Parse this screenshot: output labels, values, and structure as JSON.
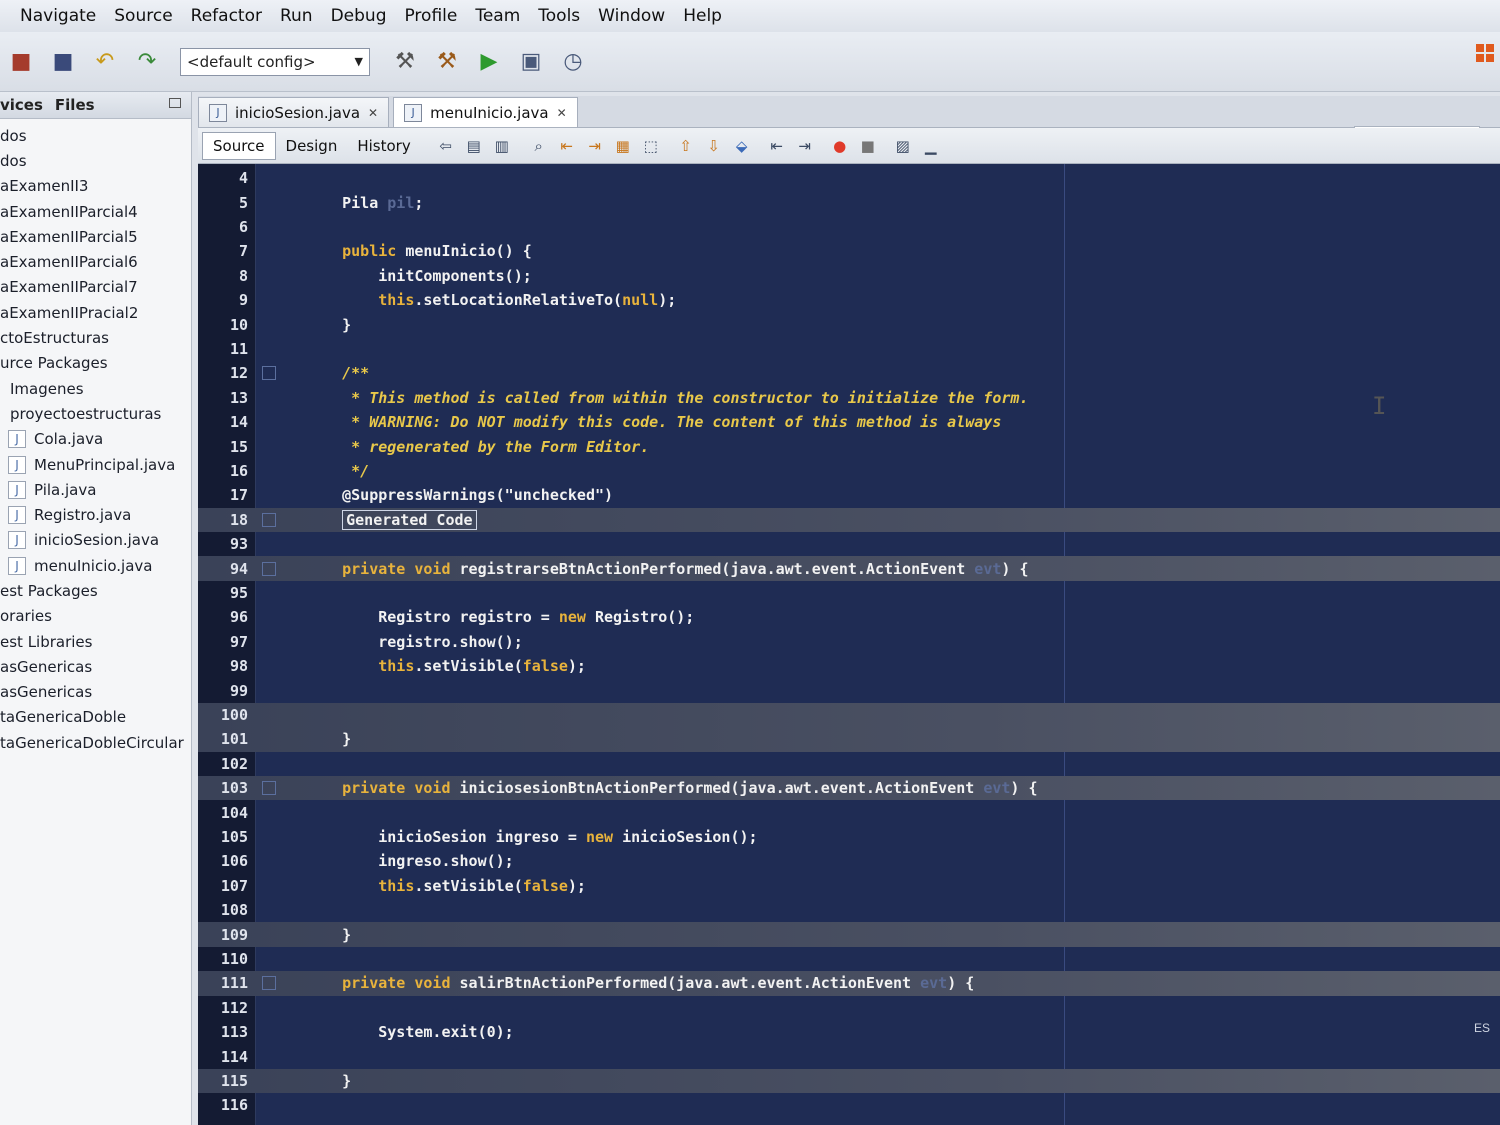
{
  "menu": [
    "Navigate",
    "Source",
    "Refactor",
    "Run",
    "Debug",
    "Profile",
    "Team",
    "Tools",
    "Window",
    "Help"
  ],
  "toolbar": {
    "config": "<default config>"
  },
  "project_panel": {
    "tabs": [
      "vices",
      "Files"
    ],
    "items": [
      {
        "label": "dos",
        "icon": false,
        "indent": 0
      },
      {
        "label": "dos",
        "icon": false,
        "indent": 0
      },
      {
        "label": "aExamenII3",
        "icon": false,
        "indent": 0
      },
      {
        "label": "aExamenIIParcial4",
        "icon": false,
        "indent": 0
      },
      {
        "label": "aExamenIIParcial5",
        "icon": false,
        "indent": 0
      },
      {
        "label": "aExamenIIParcial6",
        "icon": false,
        "indent": 0
      },
      {
        "label": "aExamenIIParcial7",
        "icon": false,
        "indent": 0
      },
      {
        "label": "aExamenIIPracial2",
        "icon": false,
        "indent": 0
      },
      {
        "label": "ctoEstructuras",
        "icon": false,
        "indent": 0
      },
      {
        "label": "urce Packages",
        "icon": false,
        "indent": 0
      },
      {
        "label": "Imagenes",
        "icon": false,
        "indent": 10
      },
      {
        "label": "proyectoestructuras",
        "icon": false,
        "indent": 10
      },
      {
        "label": "Cola.java",
        "icon": true,
        "indent": 8
      },
      {
        "label": "MenuPrincipal.java",
        "icon": true,
        "indent": 8
      },
      {
        "label": "Pila.java",
        "icon": true,
        "indent": 8
      },
      {
        "label": "Registro.java",
        "icon": true,
        "indent": 8
      },
      {
        "label": "inicioSesion.java",
        "icon": true,
        "indent": 8
      },
      {
        "label": "menuInicio.java",
        "icon": true,
        "indent": 8
      },
      {
        "label": "est Packages",
        "icon": false,
        "indent": 0
      },
      {
        "label": "oraries",
        "icon": false,
        "indent": 0
      },
      {
        "label": "est Libraries",
        "icon": false,
        "indent": 0
      },
      {
        "label": "asGenericas",
        "icon": false,
        "indent": 0
      },
      {
        "label": "asGenericas",
        "icon": false,
        "indent": 0
      },
      {
        "label": "taGenericaDoble",
        "icon": false,
        "indent": 0
      },
      {
        "label": "taGenericaDobleCircular",
        "icon": false,
        "indent": 0
      }
    ]
  },
  "editor_tabs": [
    {
      "label": "inicioSesion.java",
      "active": false
    },
    {
      "label": "menuInicio.java",
      "active": true
    }
  ],
  "editor_subtabs": [
    {
      "label": "Source",
      "active": true
    },
    {
      "label": "Design",
      "active": false
    },
    {
      "label": "History",
      "active": false
    }
  ],
  "code_lines": [
    {
      "n": "4",
      "fold": false,
      "hl": false,
      "html": ""
    },
    {
      "n": "5",
      "fold": false,
      "hl": false,
      "html": "Pila <span class='dim'>pil</span>;"
    },
    {
      "n": "6",
      "fold": false,
      "hl": false,
      "html": ""
    },
    {
      "n": "7",
      "fold": false,
      "hl": false,
      "html": "<span class='kw'>public</span> menuInicio() {"
    },
    {
      "n": "8",
      "fold": false,
      "hl": false,
      "html": "    initComponents();"
    },
    {
      "n": "9",
      "fold": false,
      "hl": false,
      "html": "    <span class='kw'>this</span>.setLocationRelativeTo(<span class='kw'>null</span>);"
    },
    {
      "n": "10",
      "fold": false,
      "hl": false,
      "html": "}"
    },
    {
      "n": "11",
      "fold": false,
      "hl": false,
      "html": ""
    },
    {
      "n": "12",
      "fold": true,
      "hl": false,
      "html": "<span class='cm'>/**</span>"
    },
    {
      "n": "13",
      "fold": false,
      "hl": false,
      "html": "<span class='cm'> * This method is called from within the constructor to initialize the form.</span>"
    },
    {
      "n": "14",
      "fold": false,
      "hl": false,
      "html": "<span class='cm'> * WARNING: Do NOT modify this code. The content of this method is always</span>"
    },
    {
      "n": "15",
      "fold": false,
      "hl": false,
      "html": "<span class='cm'> * regenerated by the Form Editor.</span>"
    },
    {
      "n": "16",
      "fold": false,
      "hl": false,
      "html": "<span class='cm'> */</span>"
    },
    {
      "n": "17",
      "fold": false,
      "hl": false,
      "html": "@SuppressWarnings(\"unchecked\")"
    },
    {
      "n": "18",
      "fold": true,
      "hl": true,
      "html": "<span class='fold-box'>Generated Code</span>"
    },
    {
      "n": "93",
      "fold": false,
      "hl": false,
      "html": ""
    },
    {
      "n": "94",
      "fold": true,
      "hl": true,
      "html": "<span class='kw'>private void</span> registrarseBtnActionPerformed(java.awt.event.ActionEvent <span class='dim'>evt</span>) {"
    },
    {
      "n": "95",
      "fold": false,
      "hl": false,
      "html": ""
    },
    {
      "n": "96",
      "fold": false,
      "hl": false,
      "html": "    Registro registro = <span class='kw'>new</span> Registro();"
    },
    {
      "n": "97",
      "fold": false,
      "hl": false,
      "html": "    registro.show();"
    },
    {
      "n": "98",
      "fold": false,
      "hl": false,
      "html": "    <span class='kw'>this</span>.setVisible(<span class='kw'>false</span>);"
    },
    {
      "n": "99",
      "fold": false,
      "hl": false,
      "html": ""
    },
    {
      "n": "100",
      "fold": false,
      "hl": true,
      "html": ""
    },
    {
      "n": "101",
      "fold": false,
      "hl": true,
      "html": "}"
    },
    {
      "n": "102",
      "fold": false,
      "hl": false,
      "html": ""
    },
    {
      "n": "103",
      "fold": true,
      "hl": true,
      "html": "<span class='kw'>private void</span> iniciosesionBtnActionPerformed(java.awt.event.ActionEvent <span class='dim'>evt</span>) {"
    },
    {
      "n": "104",
      "fold": false,
      "hl": false,
      "html": ""
    },
    {
      "n": "105",
      "fold": false,
      "hl": false,
      "html": "    inicioSesion ingreso = <span class='kw'>new</span> inicioSesion();"
    },
    {
      "n": "106",
      "fold": false,
      "hl": false,
      "html": "    ingreso.show();"
    },
    {
      "n": "107",
      "fold": false,
      "hl": false,
      "html": "    <span class='kw'>this</span>.setVisible(<span class='kw'>false</span>);"
    },
    {
      "n": "108",
      "fold": false,
      "hl": false,
      "html": ""
    },
    {
      "n": "109",
      "fold": false,
      "hl": true,
      "html": "}"
    },
    {
      "n": "110",
      "fold": false,
      "hl": false,
      "html": ""
    },
    {
      "n": "111",
      "fold": true,
      "hl": true,
      "html": "<span class='kw'>private void</span> salirBtnActionPerformed(java.awt.event.ActionEvent <span class='dim'>evt</span>) {"
    },
    {
      "n": "112",
      "fold": false,
      "hl": false,
      "html": ""
    },
    {
      "n": "113",
      "fold": false,
      "hl": false,
      "html": "    System.exit(0);"
    },
    {
      "n": "114",
      "fold": false,
      "hl": false,
      "html": ""
    },
    {
      "n": "115",
      "fold": false,
      "hl": true,
      "html": "}"
    },
    {
      "n": "116",
      "fold": false,
      "hl": false,
      "html": ""
    }
  ],
  "tray": {
    "lang": "ES"
  }
}
